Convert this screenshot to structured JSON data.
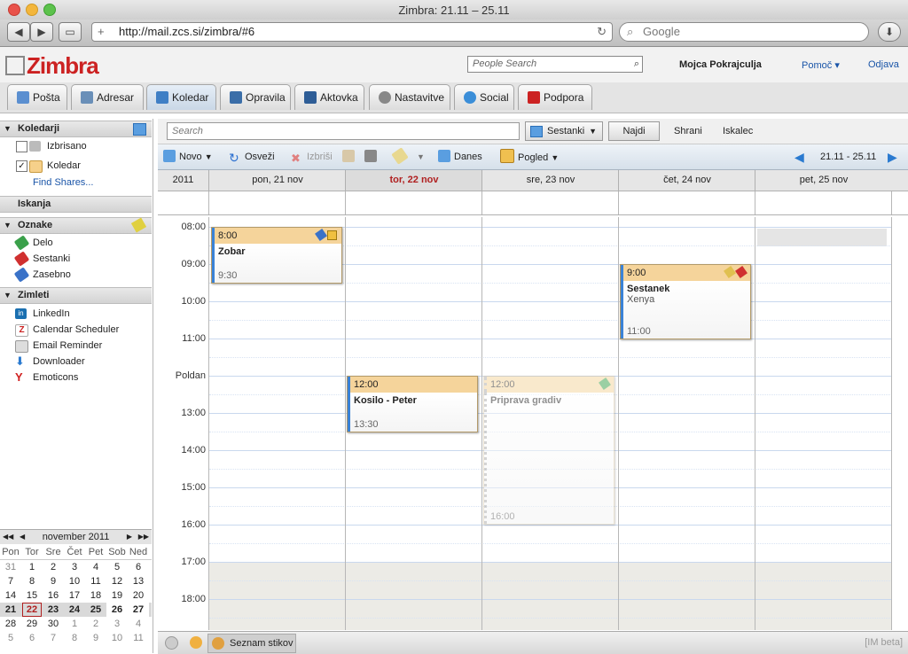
{
  "window": {
    "title": "Zimbra: 21.11 – 25.11",
    "url": "http://mail.zcs.si/zimbra/#6",
    "google_placeholder": "Google"
  },
  "header": {
    "logo": "Zimbra",
    "people_search_placeholder": "People Search",
    "user": "Mojca Pokrajculja",
    "help": "Pomoč",
    "logout": "Odjava"
  },
  "tabs": [
    {
      "label": "Pošta",
      "color": "#5b8fd0"
    },
    {
      "label": "Adresar",
      "color": "#6a8fb8"
    },
    {
      "label": "Koledar",
      "color": "#3f7fc5"
    },
    {
      "label": "Opravila",
      "color": "#3b6ea8"
    },
    {
      "label": "Aktovka",
      "color": "#2e5d96"
    },
    {
      "label": "Nastavitve",
      "color": "#888888"
    },
    {
      "label": "Social",
      "color": "#3b8ed8"
    },
    {
      "label": "Podpora",
      "color": "#cc2222"
    }
  ],
  "sidebar": {
    "calendars_header": "Koledarji",
    "calendars": [
      {
        "label": "Izbrisano",
        "checked": false
      },
      {
        "label": "Koledar",
        "checked": true
      }
    ],
    "find_shares": "Find Shares...",
    "searches_header": "Iskanja",
    "tags_header": "Oznake",
    "tags": [
      {
        "label": "Delo",
        "color": "#3aa04a"
      },
      {
        "label": "Sestanki",
        "color": "#d03030"
      },
      {
        "label": "Zasebno",
        "color": "#3a72c8"
      }
    ],
    "zimlets_header": "Zimleti",
    "zimlets": [
      {
        "label": "LinkedIn",
        "color": "#1a6fb0"
      },
      {
        "label": "Calendar Scheduler",
        "color": "#cc2222"
      },
      {
        "label": "Email Reminder",
        "color": "#888888"
      },
      {
        "label": "Downloader",
        "color": "#2a7ad0"
      },
      {
        "label": "Emoticons",
        "color": "#d02020"
      }
    ]
  },
  "minical": {
    "month": "november 2011",
    "weekdays": [
      "Pon",
      "Tor",
      "Sre",
      "Čet",
      "Pet",
      "Sob",
      "Ned"
    ],
    "weeks": [
      [
        "31",
        "1",
        "2",
        "3",
        "4",
        "5",
        "6"
      ],
      [
        "7",
        "8",
        "9",
        "10",
        "11",
        "12",
        "13"
      ],
      [
        "14",
        "15",
        "16",
        "17",
        "18",
        "19",
        "20"
      ],
      [
        "21",
        "22",
        "23",
        "24",
        "25",
        "26",
        "27"
      ],
      [
        "28",
        "29",
        "30",
        "1",
        "2",
        "3",
        "4"
      ],
      [
        "5",
        "6",
        "7",
        "8",
        "9",
        "10",
        "11"
      ]
    ]
  },
  "search": {
    "placeholder": "Search",
    "type": "Sestanki",
    "find": "Najdi",
    "save": "Shrani",
    "advanced": "Iskalec"
  },
  "actions": {
    "new": "Novo",
    "refresh": "Osveži",
    "delete": "Izbriši",
    "today": "Danes",
    "view": "Pogled",
    "range": "21.11 - 25.11"
  },
  "calendar": {
    "year": "2011",
    "days": [
      "pon, 21 nov",
      "tor, 22 nov",
      "sre, 23 nov",
      "čet, 24 nov",
      "pet, 25 nov"
    ],
    "today_index": 1,
    "hours": [
      "08:00",
      "09:00",
      "10:00",
      "11:00",
      "Poldan",
      "13:00",
      "14:00",
      "15:00",
      "16:00",
      "17:00",
      "18:00"
    ],
    "appointments": [
      {
        "day": 0,
        "start": "8:00",
        "end": "9:30",
        "title": "Zobar",
        "location": ""
      },
      {
        "day": 3,
        "start": "9:00",
        "end": "11:00",
        "title": "Sestanek",
        "location": "Xenya"
      },
      {
        "day": 1,
        "start": "12:00",
        "end": "13:30",
        "title": "Kosilo - Peter",
        "location": ""
      },
      {
        "day": 2,
        "start": "12:00",
        "end": "16:00",
        "title": "Priprava gradiv",
        "location": "",
        "tentative": true
      }
    ]
  },
  "statusbar": {
    "contacts": "Seznam stikov",
    "im": "[IM beta]"
  }
}
